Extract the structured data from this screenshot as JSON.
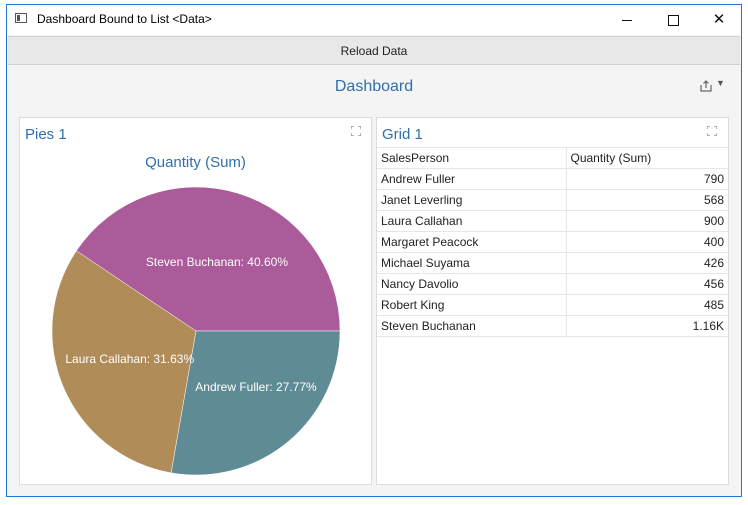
{
  "window": {
    "title": "Dashboard Bound to List <Data>"
  },
  "toolbar": {
    "reload_label": "Reload Data"
  },
  "dashboard": {
    "title": "Dashboard"
  },
  "pie_panel": {
    "title": "Pies 1",
    "chart_data": {
      "type": "pie",
      "title": "Quantity (Sum)",
      "slices": [
        {
          "label": "Steven Buchanan: 40.60%",
          "name": "Steven Buchanan",
          "percent": 40.6,
          "color": "#ab5a9a"
        },
        {
          "label": "Andrew Fuller: 27.77%",
          "name": "Andrew Fuller",
          "percent": 27.77,
          "color": "#5f8b95"
        },
        {
          "label": "Laura Callahan: 31.63%",
          "name": "Laura Callahan",
          "percent": 31.63,
          "color": "#b08c58"
        }
      ]
    }
  },
  "grid_panel": {
    "title": "Grid 1",
    "columns": [
      "SalesPerson",
      "Quantity (Sum)"
    ],
    "rows": [
      [
        "Andrew Fuller",
        "790"
      ],
      [
        "Janet Leverling",
        "568"
      ],
      [
        "Laura Callahan",
        "900"
      ],
      [
        "Margaret Peacock",
        "400"
      ],
      [
        "Michael Suyama",
        "426"
      ],
      [
        "Nancy Davolio",
        "456"
      ],
      [
        "Robert King",
        "485"
      ],
      [
        "Steven Buchanan",
        "1.16K"
      ]
    ]
  },
  "icons": {
    "app": "window-app-icon",
    "export": "export-icon",
    "maximize": "maximize-panel-icon"
  }
}
